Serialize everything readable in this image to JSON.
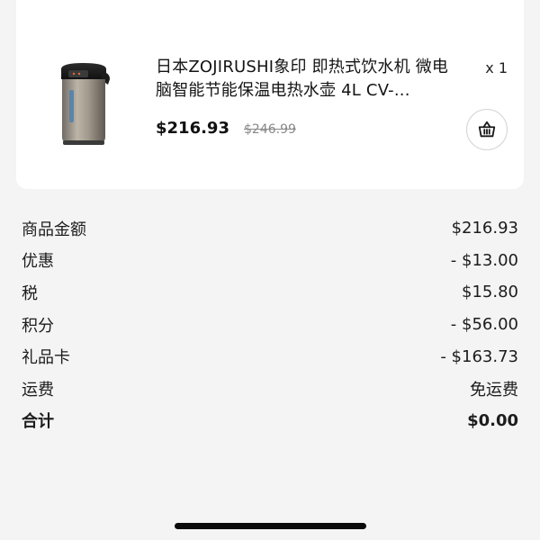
{
  "product": {
    "title": "日本ZOJIRUSHI象印 即热式饮水机 微电脑智能节能保温电热水壶 4L CV-...",
    "quantity": "x 1",
    "price": "$216.93",
    "original_price": "$246.99",
    "image_icon": "electric-water-dispenser-image",
    "cart_icon": "basket-icon"
  },
  "summary": {
    "rows": [
      {
        "label": "商品金额",
        "value": "$216.93"
      },
      {
        "label": "优惠",
        "value": "- $13.00"
      },
      {
        "label": "税",
        "value": "$15.80"
      },
      {
        "label": "积分",
        "value": "- $56.00"
      },
      {
        "label": "礼品卡",
        "value": "- $163.73"
      },
      {
        "label": "运费",
        "value": "免运费"
      }
    ],
    "total": {
      "label": "合计",
      "value": "$0.00"
    }
  },
  "colors": {
    "background": "#f4f4f4",
    "card": "#ffffff",
    "text": "#1a1a1a",
    "strikethrough": "#888888"
  }
}
